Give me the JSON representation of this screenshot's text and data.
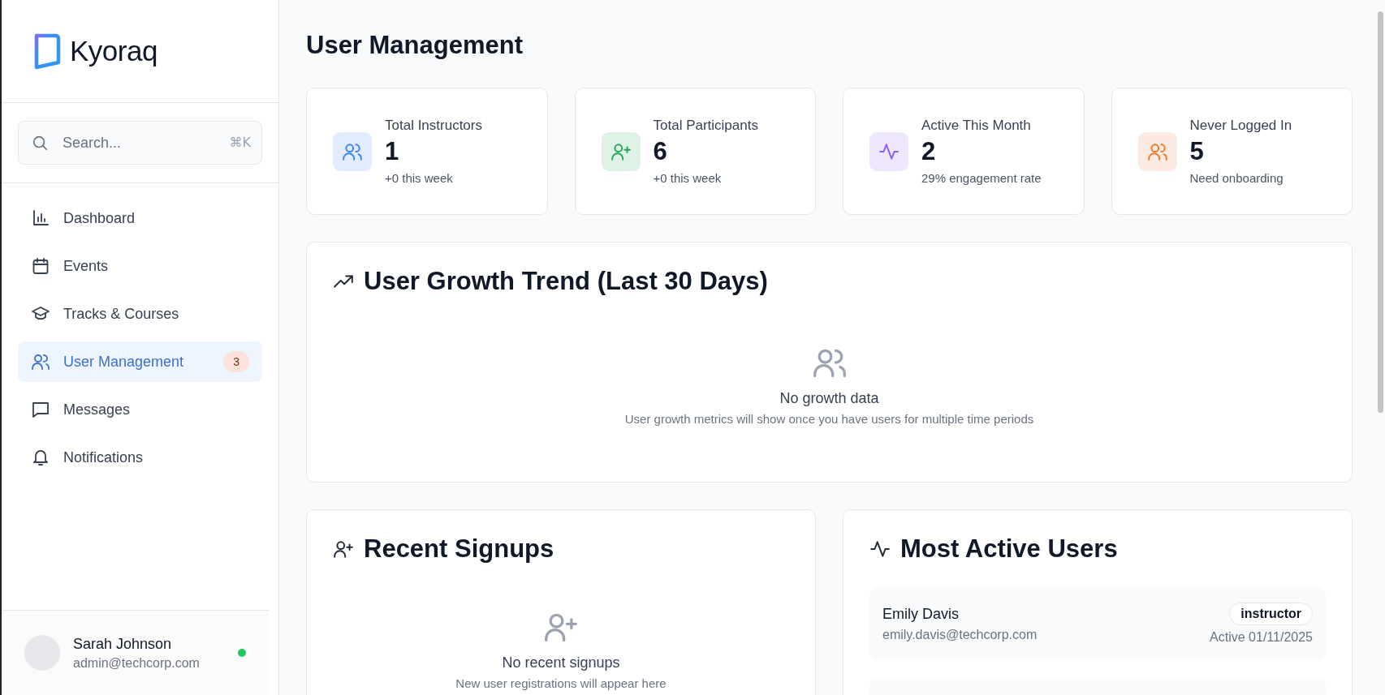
{
  "brand": {
    "name": "Kyoraq"
  },
  "search": {
    "placeholder": "Search...",
    "shortcut": "⌘K"
  },
  "nav": [
    {
      "label": "Dashboard",
      "kind": "chart",
      "selected": false
    },
    {
      "label": "Events",
      "kind": "calendar",
      "selected": false
    },
    {
      "label": "Tracks & Courses",
      "kind": "cap",
      "selected": false
    },
    {
      "label": "User Management",
      "kind": "users",
      "selected": true,
      "badge": "3"
    },
    {
      "label": "Messages",
      "kind": "chat",
      "selected": false
    },
    {
      "label": "Notifications",
      "kind": "bell",
      "selected": false
    }
  ],
  "user": {
    "name": "Sarah Johnson",
    "email": "admin@techcorp.com",
    "online": true
  },
  "page_title": "User Management",
  "stats": [
    {
      "label": "Total Instructors",
      "value": "1",
      "note": "+0 this week",
      "kind": "users",
      "color": "#3b82f6"
    },
    {
      "label": "Total Participants",
      "value": "6",
      "note": "+0 this week",
      "kind": "signup",
      "color": "#22a55a"
    },
    {
      "label": "Active This Month",
      "value": "2",
      "note": "29% engagement rate",
      "kind": "activity",
      "color": "#8b5cf6"
    },
    {
      "label": "Never Logged In",
      "value": "5",
      "note": "Need onboarding",
      "kind": "users",
      "color": "#ea7a2c"
    }
  ],
  "growth": {
    "title": "User Growth Trend (Last 30 Days)",
    "empty_title": "No growth data",
    "empty_text": "User growth metrics will show once you have users for multiple time periods"
  },
  "signups": {
    "title": "Recent Signups",
    "empty_title": "No recent signups",
    "empty_text": "New user registrations will appear here"
  },
  "active_users": {
    "title": "Most Active Users",
    "rows": [
      {
        "name": "Emily Davis",
        "email": "emily.davis@techcorp.com",
        "role": "instructor",
        "activity": "Active 01/11/2025"
      }
    ]
  }
}
